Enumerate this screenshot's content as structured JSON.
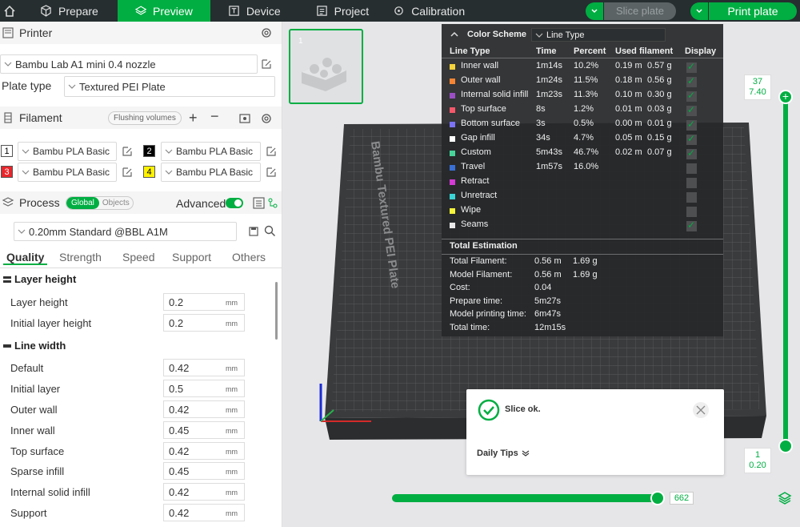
{
  "topbar": {
    "tabs": [
      {
        "label": "Prepare",
        "active": false
      },
      {
        "label": "Preview",
        "active": true
      },
      {
        "label": "Device",
        "active": false
      },
      {
        "label": "Project",
        "active": false
      },
      {
        "label": "Calibration",
        "active": false
      }
    ],
    "slice_label": "Slice plate",
    "print_label": "Print plate"
  },
  "printer": {
    "section_label": "Printer",
    "printer_name": "Bambu Lab A1 mini 0.4 nozzle",
    "plate_type_label": "Plate type",
    "plate_type_value": "Textured PEI Plate"
  },
  "filament": {
    "section_label": "Filament",
    "flushing_label": "Flushing volumes",
    "slots": [
      {
        "num": "1",
        "name": "Bambu PLA Basic",
        "color": "#ffffff",
        "text": "#000000"
      },
      {
        "num": "2",
        "name": "Bambu PLA Basic",
        "color": "#000000",
        "text": "#ffffff"
      },
      {
        "num": "3",
        "name": "Bambu PLA Basic",
        "color": "#e8262c",
        "text": "#ffffff"
      },
      {
        "num": "4",
        "name": "Bambu PLA Basic",
        "color": "#fff200",
        "text": "#000000"
      }
    ]
  },
  "process": {
    "section_label": "Process",
    "global_label": "Global",
    "objects_label": "Objects",
    "advanced_label": "Advanced",
    "preset": "0.20mm Standard @BBL A1M",
    "tabs": [
      "Quality",
      "Strength",
      "Speed",
      "Support",
      "Others"
    ],
    "groups": [
      {
        "title": "Layer height",
        "rows": [
          {
            "label": "Layer height",
            "value": "0.2",
            "unit": "mm"
          },
          {
            "label": "Initial layer height",
            "value": "0.2",
            "unit": "mm"
          }
        ]
      },
      {
        "title": "Line width",
        "rows": [
          {
            "label": "Default",
            "value": "0.42",
            "unit": "mm"
          },
          {
            "label": "Initial layer",
            "value": "0.5",
            "unit": "mm"
          },
          {
            "label": "Outer wall",
            "value": "0.42",
            "unit": "mm"
          },
          {
            "label": "Inner wall",
            "value": "0.45",
            "unit": "mm"
          },
          {
            "label": "Top surface",
            "value": "0.42",
            "unit": "mm"
          },
          {
            "label": "Sparse infill",
            "value": "0.45",
            "unit": "mm"
          },
          {
            "label": "Internal solid infill",
            "value": "0.42",
            "unit": "mm"
          },
          {
            "label": "Support",
            "value": "0.42",
            "unit": "mm"
          }
        ]
      }
    ]
  },
  "plate": {
    "thumb_number": "1",
    "bed_text": "Bambu Textured PEI Plate"
  },
  "legend": {
    "title": "Color Scheme",
    "scheme": "Line Type",
    "headers": [
      "Line Type",
      "Time",
      "Percent",
      "Used filament",
      "Display"
    ],
    "rows": [
      {
        "name": "Inner wall",
        "color": "#f5d33a",
        "time": "1m14s",
        "percent": "10.2%",
        "len": "0.19 m",
        "weight": "0.57 g",
        "display": true
      },
      {
        "name": "Outer wall",
        "color": "#f58533",
        "time": "1m24s",
        "percent": "11.5%",
        "len": "0.18 m",
        "weight": "0.56 g",
        "display": true
      },
      {
        "name": "Internal solid infill",
        "color": "#9c4fc4",
        "time": "1m23s",
        "percent": "11.3%",
        "len": "0.10 m",
        "weight": "0.30 g",
        "display": true
      },
      {
        "name": "Top surface",
        "color": "#f5586a",
        "time": "8s",
        "percent": "1.2%",
        "len": "0.01 m",
        "weight": "0.03 g",
        "display": true
      },
      {
        "name": "Bottom surface",
        "color": "#7c72f5",
        "time": "3s",
        "percent": "0.5%",
        "len": "0.00 m",
        "weight": "0.01 g",
        "display": true
      },
      {
        "name": "Gap infill",
        "color": "#ffffff",
        "time": "34s",
        "percent": "4.7%",
        "len": "0.05 m",
        "weight": "0.15 g",
        "display": true
      },
      {
        "name": "Custom",
        "color": "#47d49a",
        "time": "5m43s",
        "percent": "46.7%",
        "len": "0.02 m",
        "weight": "0.07 g",
        "display": true
      },
      {
        "name": "Travel",
        "color": "#3a6fd4",
        "time": "1m57s",
        "percent": "16.0%",
        "len": "",
        "weight": "",
        "display": false
      },
      {
        "name": "Retract",
        "color": "#d43ad4",
        "time": "",
        "percent": "",
        "len": "",
        "weight": "",
        "display": false
      },
      {
        "name": "Unretract",
        "color": "#3ad4d4",
        "time": "",
        "percent": "",
        "len": "",
        "weight": "",
        "display": false
      },
      {
        "name": "Wipe",
        "color": "#f5f53a",
        "time": "",
        "percent": "",
        "len": "",
        "weight": "",
        "display": false
      },
      {
        "name": "Seams",
        "color": "#e8e8e8",
        "time": "",
        "percent": "",
        "len": "",
        "weight": "",
        "display": true
      }
    ],
    "total_title": "Total Estimation",
    "totals": [
      {
        "label": "Total Filament:",
        "v1": "0.56 m",
        "v2": "1.69 g"
      },
      {
        "label": "Model Filament:",
        "v1": "0.56 m",
        "v2": "1.69 g"
      },
      {
        "label": "Cost:",
        "v1": "0.04",
        "v2": ""
      },
      {
        "label": "Prepare time:",
        "v1": "5m27s",
        "v2": ""
      },
      {
        "label": "Model printing time:",
        "v1": "6m47s",
        "v2": ""
      },
      {
        "label": "Total time:",
        "v1": "12m15s",
        "v2": ""
      }
    ]
  },
  "popup": {
    "status": "Slice ok.",
    "tips_label": "Daily Tips"
  },
  "layer_slider": {
    "top_layer": "37",
    "top_height": "7.40",
    "bottom_layer": "1",
    "bottom_height": "0.20",
    "move_value": "662"
  }
}
